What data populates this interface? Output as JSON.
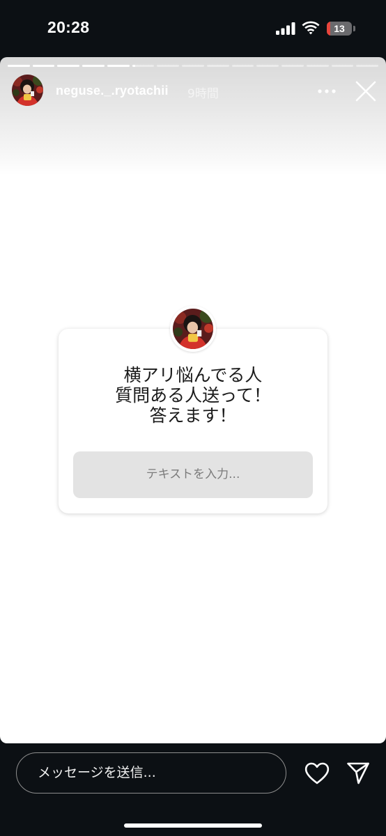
{
  "status_bar": {
    "time": "20:28",
    "battery_level": "13",
    "battery_fraction": 0.13,
    "battery_color": "#e8453c"
  },
  "story": {
    "progress": {
      "segments": 15,
      "viewed": 5,
      "current_fraction": 0.15
    },
    "header": {
      "username": "neguse._.ryotachii",
      "timestamp": "9時間",
      "avatar_icon": "profile-avatar",
      "more_icon": "more-horizontal-icon",
      "close_icon": "close-icon"
    },
    "question_sticker": {
      "question_lines": [
        "横アリ悩んでる人",
        "質問ある人送って！",
        "答えます！"
      ],
      "input_placeholder": "テキストを入力..."
    }
  },
  "reply_bar": {
    "message_placeholder": "メッセージを送信...",
    "like_icon": "heart-icon",
    "send_icon": "send-icon"
  }
}
